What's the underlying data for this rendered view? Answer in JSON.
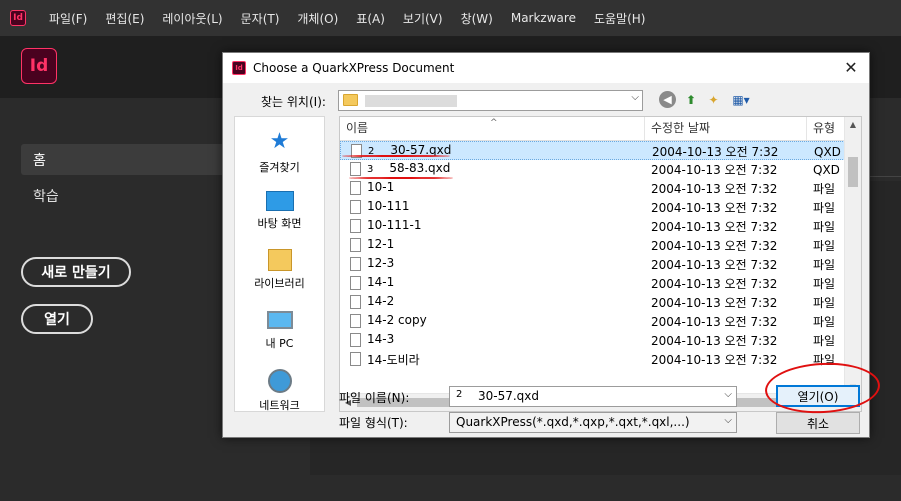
{
  "app": {
    "icon_text": "Id",
    "menu": [
      "파일(F)",
      "편집(E)",
      "레이아웃(L)",
      "문자(T)",
      "개체(O)",
      "표(A)",
      "보기(V)",
      "창(W)",
      "Markzware",
      "도움말(H)"
    ],
    "logo_text": "Id",
    "nav": {
      "home": "홈",
      "learn": "학습"
    },
    "buttons": {
      "new": "새로 만들기",
      "open": "열기"
    }
  },
  "dialog": {
    "icon_text": "Id",
    "title": "Choose a QuarkXPress Document",
    "close_glyph": "✕",
    "look_in_label": "찾는 위치(I):",
    "places": [
      {
        "label": "즐겨찾기",
        "icon": "star-icon"
      },
      {
        "label": "바탕 화면",
        "icon": "desktop-icon"
      },
      {
        "label": "라이브러리",
        "icon": "library-icon"
      },
      {
        "label": "내 PC",
        "icon": "pc-icon"
      },
      {
        "label": "네트워크",
        "icon": "network-icon"
      }
    ],
    "columns": {
      "name": "이름",
      "date": "수정한 날짜",
      "type": "유형"
    },
    "files": [
      {
        "prefix": "2",
        "name": "30-57.qxd",
        "date": "2004-10-13 오전 7:32",
        "type": "QXD 파"
      },
      {
        "prefix": "3",
        "name": "58-83.qxd",
        "date": "2004-10-13 오전 7:32",
        "type": "QXD 파"
      },
      {
        "prefix": "",
        "name": "10-1",
        "date": "2004-10-13 오전 7:32",
        "type": "파일"
      },
      {
        "prefix": "",
        "name": "10-111",
        "date": "2004-10-13 오전 7:32",
        "type": "파일"
      },
      {
        "prefix": "",
        "name": "10-111-1",
        "date": "2004-10-13 오전 7:32",
        "type": "파일"
      },
      {
        "prefix": "",
        "name": "12-1",
        "date": "2004-10-13 오전 7:32",
        "type": "파일"
      },
      {
        "prefix": "",
        "name": "12-3",
        "date": "2004-10-13 오전 7:32",
        "type": "파일"
      },
      {
        "prefix": "",
        "name": "14-1",
        "date": "2004-10-13 오전 7:32",
        "type": "파일"
      },
      {
        "prefix": "",
        "name": "14-2",
        "date": "2004-10-13 오전 7:32",
        "type": "파일"
      },
      {
        "prefix": "",
        "name": "14-2 copy",
        "date": "2004-10-13 오전 7:32",
        "type": "파일"
      },
      {
        "prefix": "",
        "name": "14-3",
        "date": "2004-10-13 오전 7:32",
        "type": "파일"
      },
      {
        "prefix": "",
        "name": "14-도비라",
        "date": "2004-10-13 오전 7:32",
        "type": "파일"
      }
    ],
    "selected_index": 0,
    "file_name_label": "파일 이름(N):",
    "file_name_prefix": "2",
    "file_name_value": "30-57.qxd",
    "file_type_label": "파일 형식(T):",
    "file_type_value": "QuarkXPress(*.qxd,*.qxp,*.qxt,*.qxl,...)",
    "open_button": "열기(O)",
    "cancel_button": "취소",
    "annotation_color": "#e01010"
  }
}
